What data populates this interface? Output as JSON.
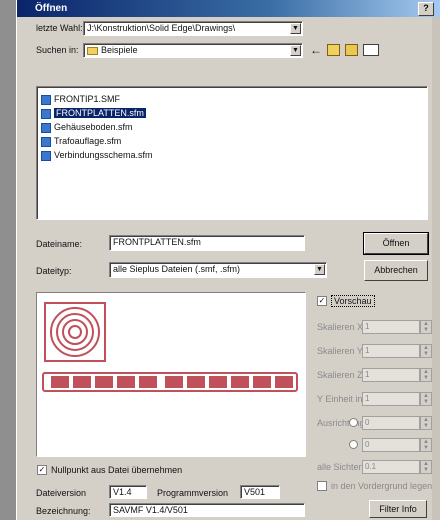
{
  "window": {
    "title": "Öffnen",
    "help_button": "?",
    "bg_color": "#d4d0c8"
  },
  "recent": {
    "label": "letzte Wahl:",
    "value": "J:\\Konstruktion\\Solid Edge\\Drawings\\"
  },
  "lookin": {
    "label": "Suchen in:",
    "value": "Beispiele"
  },
  "files": [
    {
      "name": "FRONTIP1.SMF",
      "selected": false
    },
    {
      "name": "FRONTPLATTEN.sfm",
      "selected": true
    },
    {
      "name": "Gehäuseboden.sfm",
      "selected": false
    },
    {
      "name": "Trafoauflage.sfm",
      "selected": false
    },
    {
      "name": "Verbindungsschema.sfm",
      "selected": false
    }
  ],
  "filename": {
    "label": "Dateiname:",
    "value": "FRONTPLATTEN.sfm"
  },
  "filetype": {
    "label": "Dateityp:",
    "value": "alle Sieplus Dateien (.smf, .sfm)"
  },
  "buttons": {
    "open": "Öffnen",
    "cancel": "Abbrechen",
    "fileinfo": "Filter Info"
  },
  "preview_check": {
    "label": "Vorschau",
    "checked": true
  },
  "spin_fields": [
    {
      "label": "Skalieren X:",
      "value": "1"
    },
    {
      "label": "Skalieren Y:",
      "value": "1"
    },
    {
      "label": "Skalieren Z:",
      "value": "1"
    },
    {
      "label": "Y Einheit in:",
      "value": "1"
    },
    {
      "label": "Ausrichtung:",
      "value": "0"
    },
    {
      "label": "",
      "value": "0"
    },
    {
      "label": "alle Sichten:",
      "value": "0.1"
    }
  ],
  "origin_check": {
    "label": "Nullpunkt aus Datei übernehmen",
    "checked": true
  },
  "extra_check": {
    "label": "in den Vordergrund legen",
    "checked": false
  },
  "meta": {
    "file_version_label": "Dateiversion",
    "file_version": "V1.4",
    "program_version_label": "Programmversion",
    "program_version": "V501",
    "description_label": "Bezeichnung:",
    "description": "SAVMF V1.4/V501"
  },
  "accent": "#0a246a",
  "preview_color": "#c0505a"
}
